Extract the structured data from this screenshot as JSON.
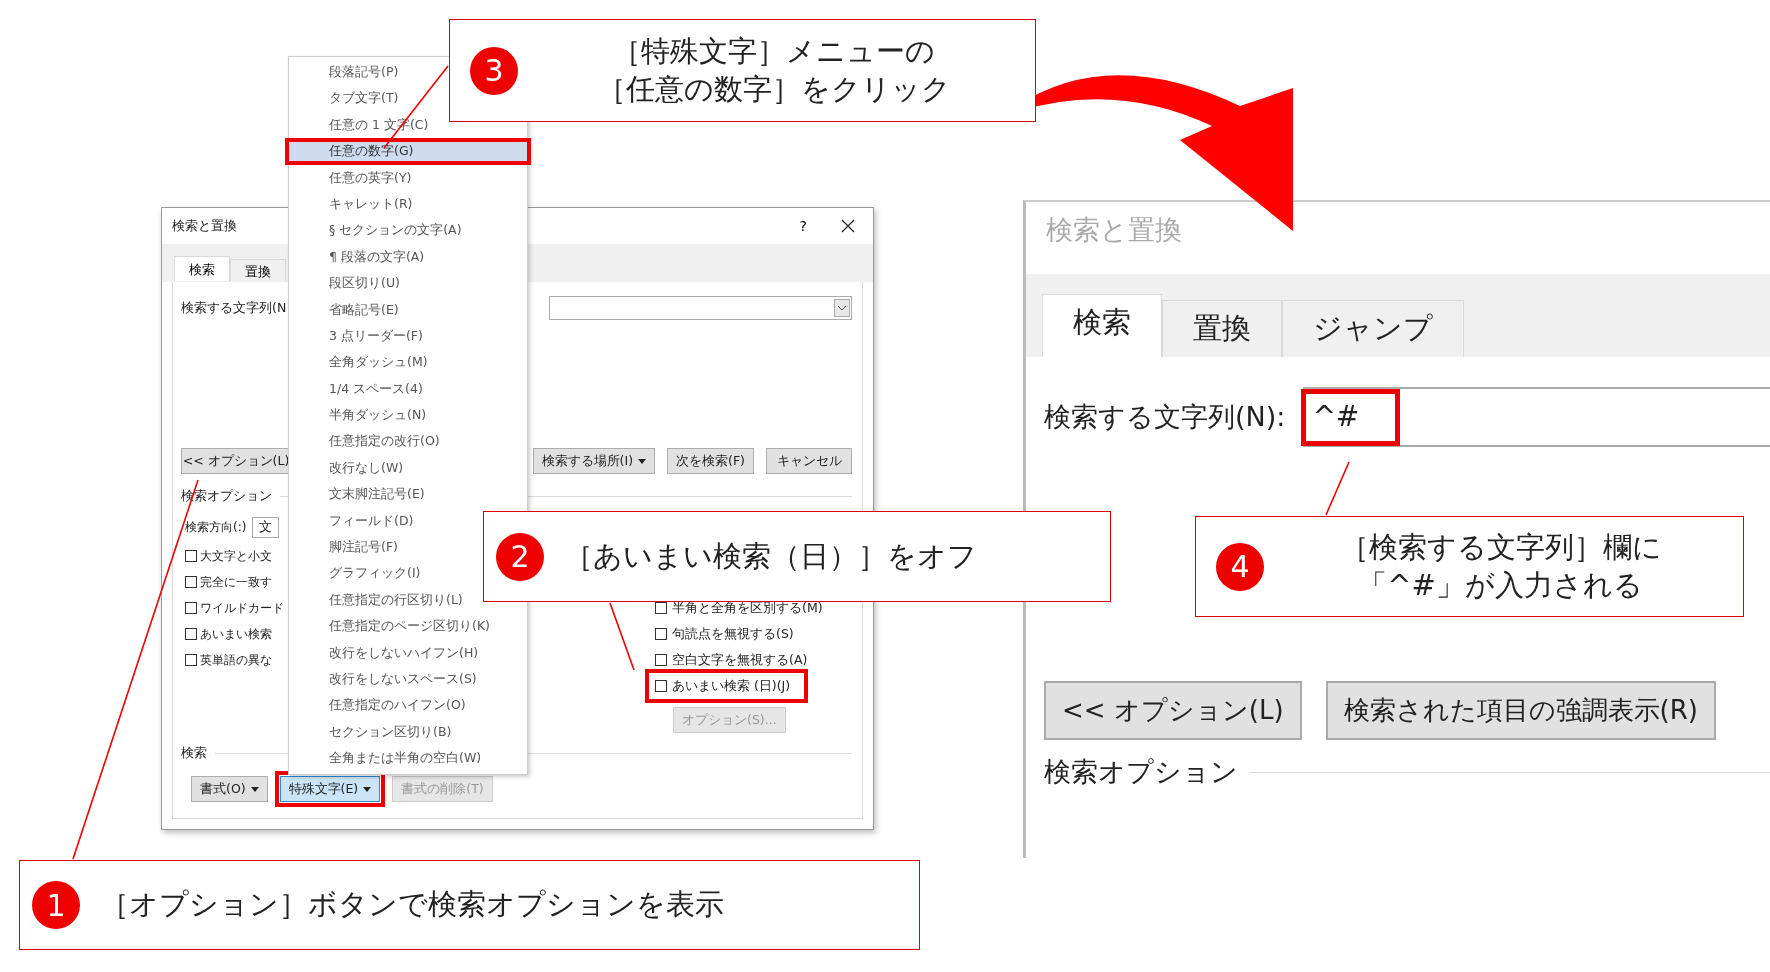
{
  "left_dialog": {
    "title": "検索と置換",
    "help": "?",
    "tabs": [
      {
        "label": "検索",
        "selected": true
      },
      {
        "label": "置換",
        "selected": false
      }
    ],
    "find_label": "検索する文字列(N",
    "options_button": "<< オプション(L)",
    "actions": [
      {
        "label": "検索する場所(I)",
        "caret": true
      },
      {
        "label": "次を検索(F)",
        "caret": false
      },
      {
        "label": "キャンセル",
        "caret": false
      }
    ],
    "options_section": "検索オプション",
    "direction_label": "検索方向(:)",
    "direction_value": "文",
    "left_checks": [
      {
        "label": "大文字と小文",
        "checked": false
      },
      {
        "label": "完全に一致す",
        "checked": false
      },
      {
        "label": "ワイルドカード",
        "checked": false
      },
      {
        "label": "あいまい検索",
        "checked": false
      },
      {
        "label": "英単語の異な",
        "checked": false
      }
    ],
    "right_checks": [
      {
        "label": "半角と全角を区別する(M)",
        "checked": false,
        "highlighted": false
      },
      {
        "label": "句読点を無視する(S)",
        "checked": false,
        "highlighted": false
      },
      {
        "label": "空白文字を無視する(A)",
        "checked": false,
        "highlighted": false
      },
      {
        "label": "あいまい検索 (日)(J)",
        "checked": false,
        "highlighted": true
      }
    ],
    "fuzzy_options": {
      "label": "オプション(S)...",
      "disabled": true
    },
    "search_section": "検索",
    "bottom_buttons": [
      {
        "label": "書式(O)",
        "caret": true,
        "disabled": false,
        "highlighted": false
      },
      {
        "label": "特殊文字(E)",
        "caret": true,
        "disabled": false,
        "highlighted": true
      },
      {
        "label": "書式の削除(T)",
        "caret": false,
        "disabled": true,
        "highlighted": false
      }
    ]
  },
  "special_menu": {
    "items": [
      {
        "label": "段落記号(P)",
        "selected": false
      },
      {
        "label": "タブ文字(T)",
        "selected": false
      },
      {
        "label": "任意の 1 文字(C)",
        "selected": false
      },
      {
        "label": "任意の数字(G)",
        "selected": true
      },
      {
        "label": "任意の英字(Y)",
        "selected": false
      },
      {
        "label": "キャレット(R)",
        "selected": false
      },
      {
        "label": "§ セクションの文字(A)",
        "selected": false
      },
      {
        "label": "¶ 段落の文字(A)",
        "selected": false
      },
      {
        "label": "段区切り(U)",
        "selected": false
      },
      {
        "label": "省略記号(E)",
        "selected": false
      },
      {
        "label": "3 点リーダー(F)",
        "selected": false
      },
      {
        "label": "全角ダッシュ(M)",
        "selected": false
      },
      {
        "label": "1/4 スペース(4)",
        "selected": false
      },
      {
        "label": "半角ダッシュ(N)",
        "selected": false
      },
      {
        "label": "任意指定の改行(O)",
        "selected": false
      },
      {
        "label": "改行なし(W)",
        "selected": false
      },
      {
        "label": "文末脚注記号(E)",
        "selected": false
      },
      {
        "label": "フィールド(D)",
        "selected": false
      },
      {
        "label": "脚注記号(F)",
        "selected": false
      },
      {
        "label": "グラフィック(I)",
        "selected": false
      },
      {
        "label": "任意指定の行区切り(L)",
        "selected": false
      },
      {
        "label": "任意指定のページ区切り(K)",
        "selected": false
      },
      {
        "label": "改行をしないハイフン(H)",
        "selected": false
      },
      {
        "label": "改行をしないスペース(S)",
        "selected": false
      },
      {
        "label": "任意指定のハイフン(O)",
        "selected": false
      },
      {
        "label": "セクション区切り(B)",
        "selected": false
      },
      {
        "label": "全角または半角の空白(W)",
        "selected": false
      }
    ]
  },
  "right_dialog": {
    "title": "検索と置換",
    "tabs": [
      {
        "label": "検索",
        "selected": true
      },
      {
        "label": "置換",
        "selected": false
      },
      {
        "label": "ジャンプ",
        "selected": false
      }
    ],
    "find_label": "検索する文字列(N):",
    "find_value": "^#",
    "find_highlighted": true,
    "buttons": [
      "<< オプション(L)",
      "検索された項目の強調表示(R)"
    ],
    "options_section": "検索オプション"
  },
  "callouts": [
    {
      "number": "3",
      "lines": [
        "［特殊文字］メニューの",
        "［任意の数字］をクリック"
      ]
    },
    {
      "number": "2",
      "lines": [
        "［あいまい検索（日）］をオフ"
      ]
    },
    {
      "number": "4",
      "lines": [
        "［検索する文字列］欄に",
        "「^#」が入力される"
      ]
    },
    {
      "number": "1",
      "lines": [
        "［オプション］ボタンで検索オプションを表示"
      ]
    }
  ]
}
